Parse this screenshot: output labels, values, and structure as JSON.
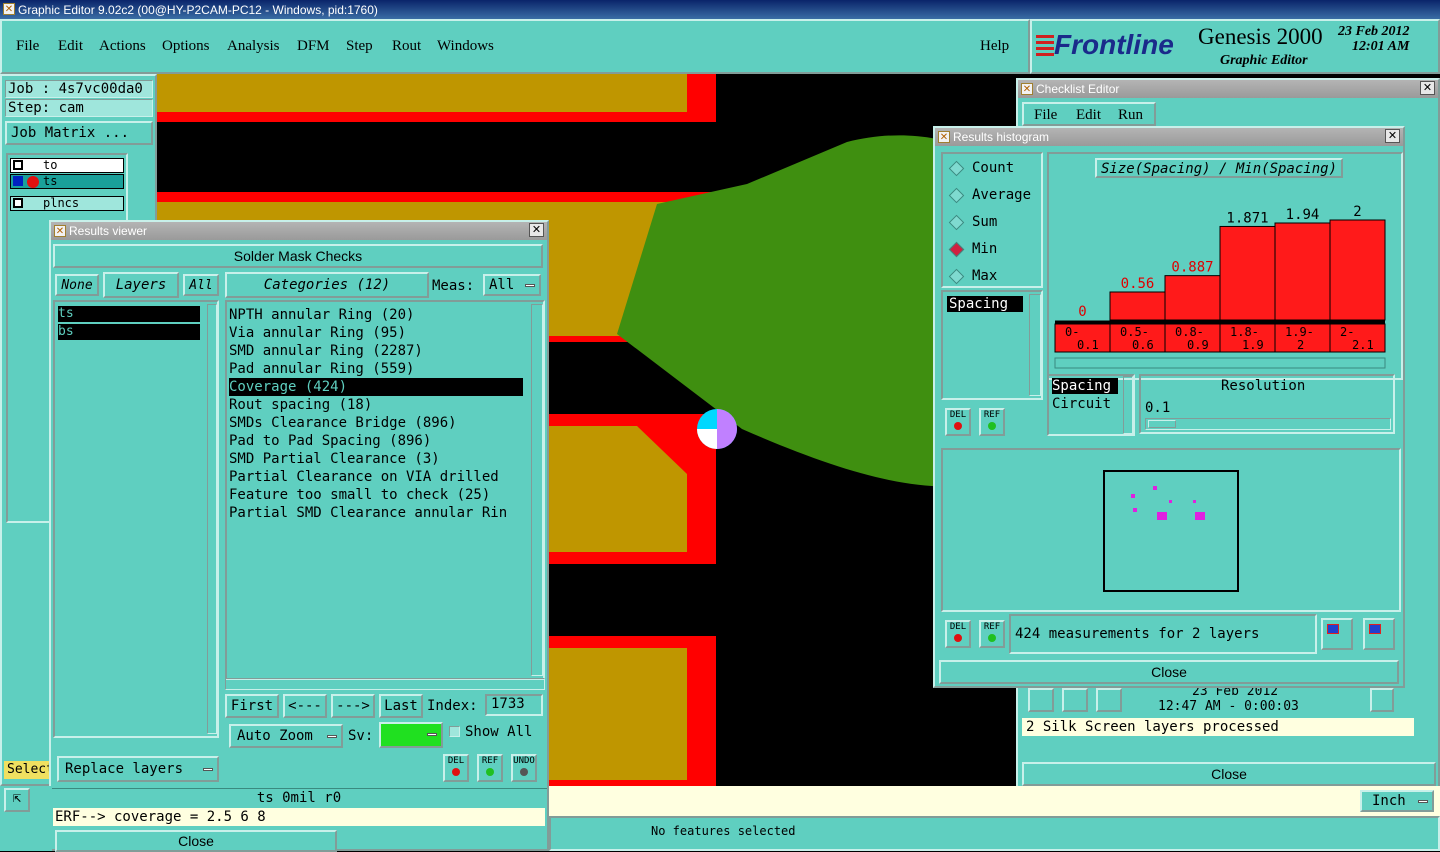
{
  "window": {
    "title": "Graphic Editor 9.02c2 (00@HY-P2CAM-PC12 - Windows, pid:1760)"
  },
  "menu": {
    "items": [
      "File",
      "Edit",
      "Actions",
      "Options",
      "Analysis",
      "DFM",
      "Step",
      "Rout",
      "Windows"
    ],
    "help": "Help"
  },
  "brand": {
    "logo": "Frontline",
    "product": "Genesis 2000",
    "subtitle": "Graphic Editor",
    "date": "23 Feb 2012",
    "time": "12:01 AM"
  },
  "left_panel": {
    "job": "Job : 4s7vc00da0",
    "step": "Step: cam",
    "job_matrix": "Job Matrix ...",
    "layers": [
      "to",
      "ts",
      "plncs"
    ],
    "select": "Select"
  },
  "results_viewer": {
    "title": "Results viewer",
    "heading": "Solder Mask Checks",
    "none": "None",
    "layers": "Layers",
    "all": "All",
    "categories_label": "Categories (12)",
    "meas": "Meas:",
    "meas_value": "All",
    "layer_items": [
      "ts",
      "bs"
    ],
    "categories": [
      "NPTH annular Ring (20)",
      "Via annular Ring (95)",
      "SMD annular Ring (2287)",
      "Pad annular Ring (559)",
      "Coverage (424)",
      "Rout spacing (18)",
      "SMDs Clearance Bridge (896)",
      "Pad to Pad Spacing (896)",
      "SMD Partial Clearance (3)",
      "Partial Clearance on VIA drilled",
      "Feature too small to check (25)",
      "Partial SMD Clearance annular Rin"
    ],
    "selected_category": 4,
    "first": "First",
    "prev": "<---",
    "next": "--->",
    "last": "Last",
    "index_label": "Index:",
    "index_value": "1733",
    "auto_zoom": "Auto Zoom",
    "sv": "Sv:",
    "show_all": "Show All",
    "replace_layers": "Replace layers",
    "del": "DEL",
    "ref": "REF",
    "undo": "UNDO",
    "status": "ts 0mil  r0",
    "erf": "ERF--> coverage = 2.5 6 8",
    "close": "Close"
  },
  "checklist": {
    "title": "Checklist Editor",
    "menu": [
      "File",
      "Edit",
      "Run"
    ],
    "date": "23 Feb 2012",
    "time": "12:47 AM - 0:00:03",
    "message": "2 Silk Screen layers processed",
    "close": "Close"
  },
  "histogram": {
    "title": "Results histogram",
    "modes": [
      "Count",
      "Average",
      "Sum",
      "Min",
      "Max"
    ],
    "selected_mode": "Min",
    "chart_title": "Size(Spacing) / Min(Spacing)",
    "list_items": [
      "Spacing"
    ],
    "list2": [
      "Spacing",
      "Circuit"
    ],
    "resolution_label": "Resolution",
    "resolution_value": "0.1",
    "summary": "424 measurements for 2 layers",
    "close": "Close",
    "del": "DEL",
    "ref": "REF"
  },
  "chart_data": {
    "type": "bar",
    "title": "Size(Spacing) / Min(Spacing)",
    "categories": [
      "0-\n0.1",
      "0.5-\n0.6",
      "0.8-\n0.9",
      "1.8-\n1.9",
      "1.9-\n2",
      "2-\n2.1"
    ],
    "values": [
      0,
      0.56,
      0.887,
      1.871,
      1.94,
      2
    ],
    "labels": [
      "0",
      "0.56",
      "0.887",
      "1.871",
      "1.94",
      "2"
    ],
    "bar_color": "#ff1a1a"
  },
  "bottom": {
    "status": "No features selected",
    "units": "Inch"
  }
}
